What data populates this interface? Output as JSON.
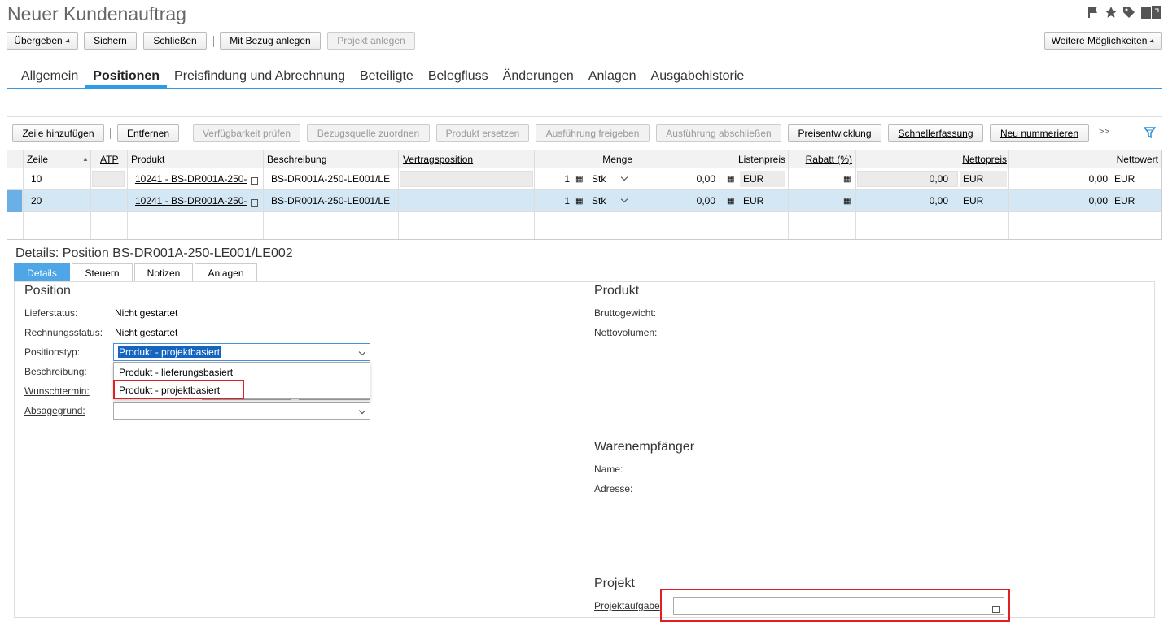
{
  "app": {
    "title": "Neuer Kundenauftrag"
  },
  "toolbar": {
    "submit": "Übergeben",
    "save": "Sichern",
    "close": "Schließen",
    "create_ref": "Mit Bezug anlegen",
    "create_project": "Projekt anlegen",
    "more": "Weitere Möglichkeiten"
  },
  "tabs": [
    "Allgemein",
    "Positionen",
    "Preisfindung und Abrechnung",
    "Beteiligte",
    "Belegfluss",
    "Änderungen",
    "Anlagen",
    "Ausgabehistorie"
  ],
  "items_toolbar": {
    "add": "Zeile hinzufügen",
    "remove": "Entfernen",
    "check": "Verfügbarkeit prüfen",
    "source": "Bezugsquelle zuordnen",
    "replace": "Produkt ersetzen",
    "release": "Ausführung freigeben",
    "finish": "Ausführung abschließen",
    "price": "Preisentwicklung",
    "quick": "Schnellerfassung",
    "renumber": "Neu nummerieren",
    "more": ">>"
  },
  "table": {
    "headers": {
      "line": "Zeile",
      "atp": "ATP",
      "product": "Produkt",
      "desc": "Beschreibung",
      "contract": "Vertragsposition",
      "qty": "Menge",
      "list": "Listenpreis",
      "discount": "Rabatt (%)",
      "net": "Nettopreis",
      "netvalue": "Nettowert"
    },
    "rows": [
      {
        "line": "10",
        "product": "10241 - BS-DR001A-250-",
        "desc": "BS-DR001A-250-LE001/LE",
        "qty": "1",
        "unit": "Stk",
        "list": "0,00",
        "cur": "EUR",
        "net": "0,00",
        "ncur": "EUR",
        "nv": "0,00",
        "nvcur": "EUR"
      },
      {
        "line": "20",
        "product": "10241 - BS-DR001A-250-",
        "desc": "BS-DR001A-250-LE001/LE",
        "qty": "1",
        "unit": "Stk",
        "list": "0,00",
        "cur": "EUR",
        "net": "0,00",
        "ncur": "EUR",
        "nv": "0,00",
        "nvcur": "EUR"
      }
    ]
  },
  "details": {
    "title": "Details: Position BS-DR001A-250-LE001/LE002",
    "tabs": [
      "Details",
      "Steuern",
      "Notizen",
      "Anlagen"
    ],
    "position": {
      "heading": "Position",
      "delivery_status_label": "Lieferstatus:",
      "delivery_status": "Nicht gestartet",
      "invoice_status_label": "Rechnungsstatus:",
      "invoice_status": "Nicht gestartet",
      "type_label": "Positionstyp:",
      "type_value": "Produkt - projektbasiert",
      "desc_label": "Beschreibung:",
      "date_label": "Wunschtermin:",
      "reason_label": "Absagegrund:",
      "options": [
        "Produkt - lieferungsbasiert",
        "Produkt - projektbasiert"
      ]
    },
    "product": {
      "heading": "Produkt",
      "gross_label": "Bruttogewicht:",
      "vol_label": "Nettovolumen:"
    },
    "recipient": {
      "heading": "Warenempfänger",
      "name_label": "Name:",
      "address_label": "Adresse:"
    },
    "project": {
      "heading": "Projekt",
      "task_label": "Projektaufgabe"
    }
  }
}
